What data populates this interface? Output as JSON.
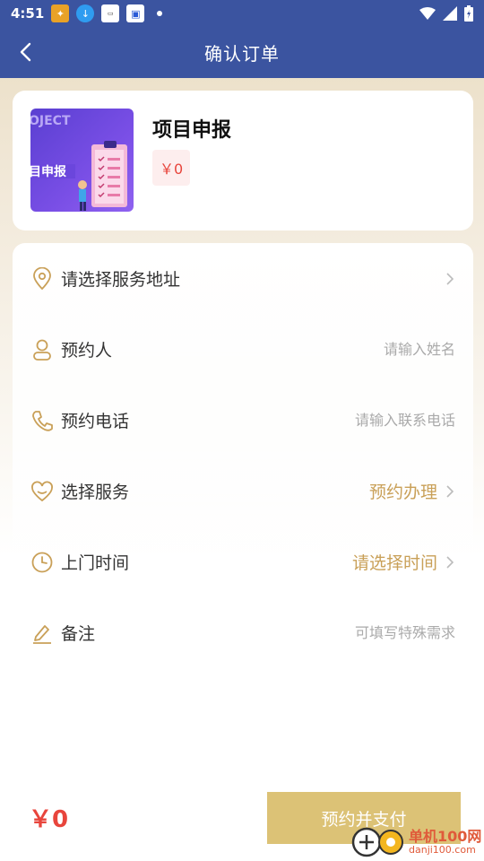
{
  "status_bar": {
    "time": "4:51"
  },
  "header": {
    "title": "确认订单"
  },
  "product": {
    "name": "项目申报",
    "price": "￥0",
    "thumb_text_top": "OJECT",
    "thumb_text_main": "目申报"
  },
  "form": {
    "address": {
      "label": "请选择服务地址"
    },
    "booker": {
      "label": "预约人",
      "placeholder": "请输入姓名"
    },
    "phone": {
      "label": "预约电话",
      "placeholder": "请输入联系电话"
    },
    "service": {
      "label": "选择服务",
      "value": "预约办理"
    },
    "time": {
      "label": "上门时间",
      "value": "请选择时间"
    },
    "note": {
      "label": "备注",
      "placeholder": "可填写特殊需求"
    }
  },
  "footer": {
    "total": "￥0",
    "pay_button": "预约并支付"
  },
  "watermark": {
    "brand": "单机100网",
    "domain": "danji100.com"
  },
  "colors": {
    "header_bg": "#3b54a0",
    "gold": "#c9a058",
    "button_bg": "#dcc276",
    "price_red": "#e8453c"
  }
}
